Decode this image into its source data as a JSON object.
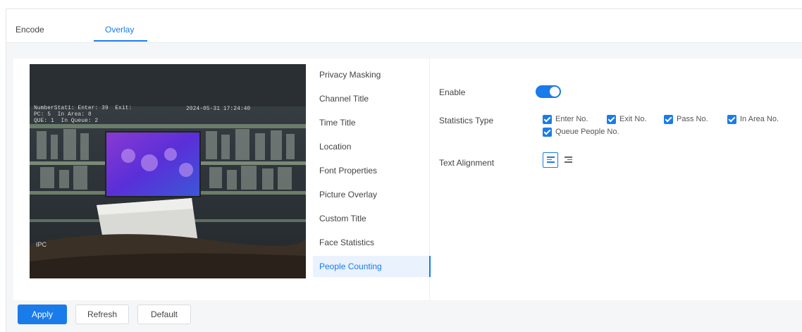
{
  "tabs": [
    {
      "label": "Encode"
    },
    {
      "label": "Overlay",
      "active": true
    }
  ],
  "preview": {
    "osd_line1": "NumberStat1: Enter: 39  Exit:",
    "osd_line2": "PC: 5  In Area: 8",
    "osd_line3": "QUE: 1  In Queue: 2",
    "osd_time": "2024-05-31 17:24:40",
    "osd_label": "IPC"
  },
  "submenu": {
    "items": [
      {
        "label": "Privacy Masking"
      },
      {
        "label": "Channel Title"
      },
      {
        "label": "Time Title"
      },
      {
        "label": "Location"
      },
      {
        "label": "Font Properties"
      },
      {
        "label": "Picture Overlay"
      },
      {
        "label": "Custom Title"
      },
      {
        "label": "Face Statistics"
      },
      {
        "label": "People Counting",
        "active": true
      }
    ]
  },
  "form": {
    "enable_label": "Enable",
    "enable_value": true,
    "statistics_type_label": "Statistics Type",
    "statistics_options": [
      {
        "label": "Enter No.",
        "checked": true
      },
      {
        "label": "Exit No.",
        "checked": true
      },
      {
        "label": "Pass No.",
        "checked": true
      },
      {
        "label": "In Area No.",
        "checked": true
      },
      {
        "label": "Queue People No.",
        "checked": true
      }
    ],
    "text_alignment_label": "Text Alignment",
    "alignment_selected": "left"
  },
  "footer": {
    "apply_label": "Apply",
    "refresh_label": "Refresh",
    "default_label": "Default"
  },
  "colors": {
    "accent": "#1a7bea",
    "panel_bg": "#ffffff",
    "page_bg": "#f5f6f8"
  },
  "icons": [
    "align-left-icon",
    "align-right-icon",
    "toggle-switch",
    "checkbox-checked"
  ]
}
